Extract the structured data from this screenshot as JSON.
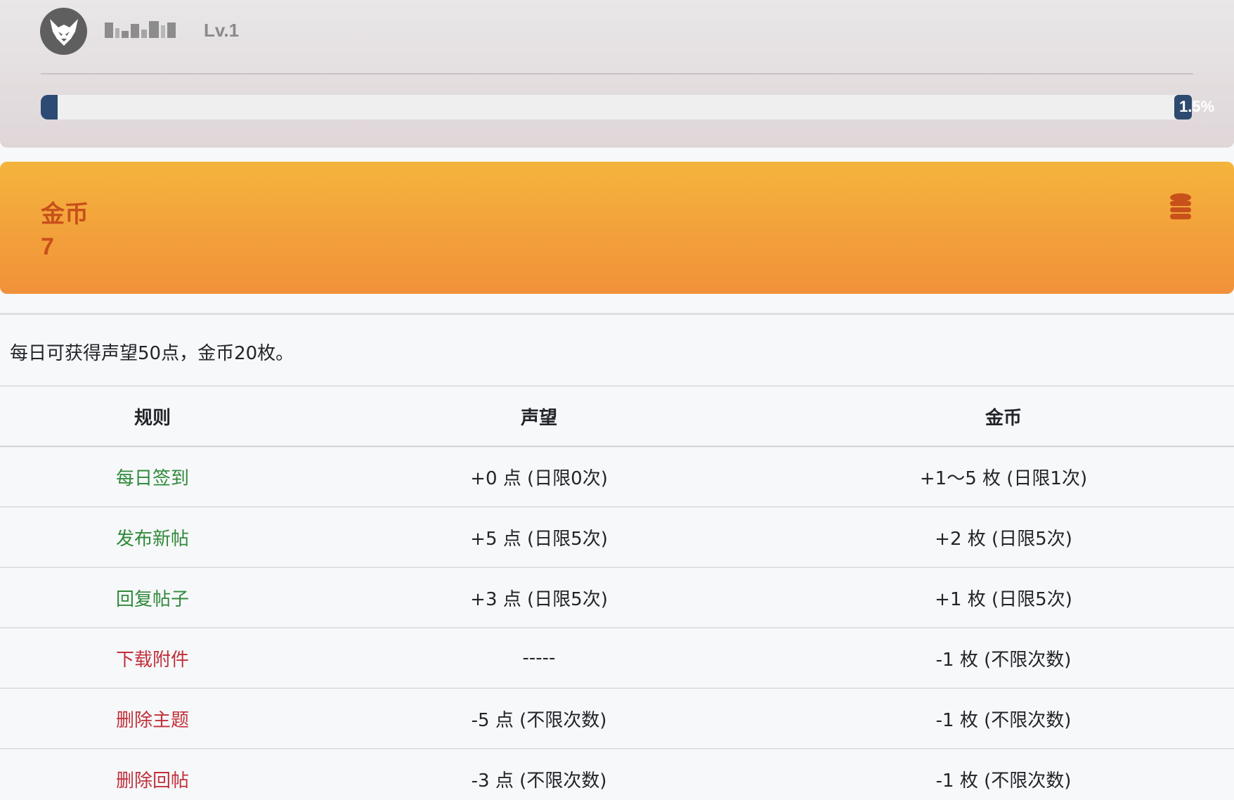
{
  "profile": {
    "avatar_icon": "demon-mask-icon",
    "level": "Lv.1",
    "progress": {
      "label": "1.5%",
      "percent": 1.5
    }
  },
  "coin_card": {
    "title": "金币",
    "value": "7",
    "icon": "coins-stack-icon",
    "gradient_top": "#f4b43c",
    "gradient_bottom": "#f1913a",
    "text_color": "#c8501a"
  },
  "rules": {
    "notice": "每日可获得声望50点，金币20枚。",
    "headers": [
      "规则",
      "声望",
      "金币"
    ],
    "rows": [
      {
        "rule": "每日签到",
        "type": "gain",
        "reputation": "+0 点 (日限0次)",
        "coins": "+1～5 枚 (日限1次)"
      },
      {
        "rule": "发布新帖",
        "type": "gain",
        "reputation": "+5 点 (日限5次)",
        "coins": "+2 枚 (日限5次)"
      },
      {
        "rule": "回复帖子",
        "type": "gain",
        "reputation": "+3 点 (日限5次)",
        "coins": "+1 枚 (日限5次)"
      },
      {
        "rule": "下载附件",
        "type": "cost",
        "reputation": "-----",
        "coins": "-1 枚 (不限次数)"
      },
      {
        "rule": "删除主题",
        "type": "cost",
        "reputation": "-5 点 (不限次数)",
        "coins": "-1 枚 (不限次数)"
      },
      {
        "rule": "删除回帖",
        "type": "cost",
        "reputation": "-3 点 (不限次数)",
        "coins": "-1 枚 (不限次数)"
      }
    ],
    "colors": {
      "gain": "#2f8a3a",
      "cost": "#c0303a"
    }
  }
}
